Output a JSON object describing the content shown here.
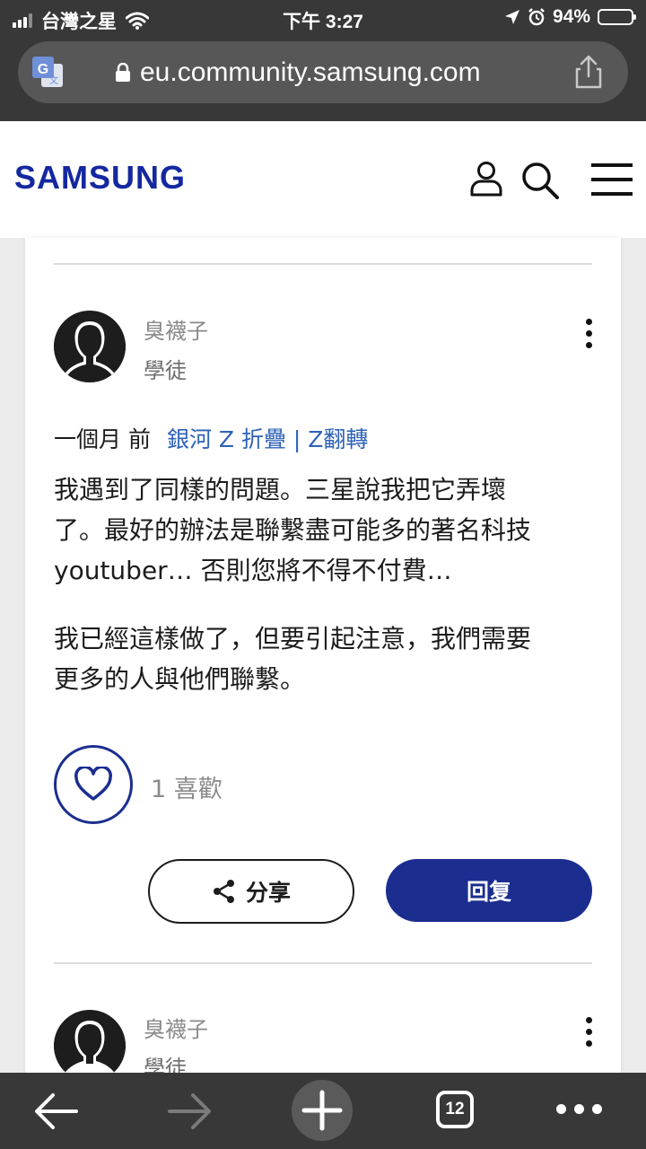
{
  "status_bar": {
    "carrier": "台灣之星",
    "time": "下午 3:27",
    "battery": "94%",
    "battery_level": 0.94
  },
  "browser": {
    "url": "eu.community.samsung.com",
    "open_tab_count": "12"
  },
  "site": {
    "logo_text": "SAMSUNG",
    "brand_color": "#1428a0"
  },
  "post": {
    "author": "臭襪子",
    "rank": "學徒",
    "time": "一個月 前",
    "board": "銀河 Z 折疊 | Z翻轉",
    "paragraph_1": [
      "我遇到了同樣的問題。三星說我把它弄壞",
      "了。最好的辦法是聯繫盡可能多的著名科技",
      "youtuber… 否則您將不得不付費…"
    ],
    "paragraph_2": [
      "我已經這樣做了，但要引起注意，我們需要",
      "更多的人與他們聯繫。"
    ],
    "like_count": "1 喜歡",
    "share_label": "分享",
    "reply_label": "回复"
  },
  "next_post": {
    "author": "臭襪子",
    "rank": "學徒"
  },
  "colors": {
    "accent": "#1b2e8f",
    "link": "#2e62b8",
    "chrome_bg": "#383838"
  }
}
